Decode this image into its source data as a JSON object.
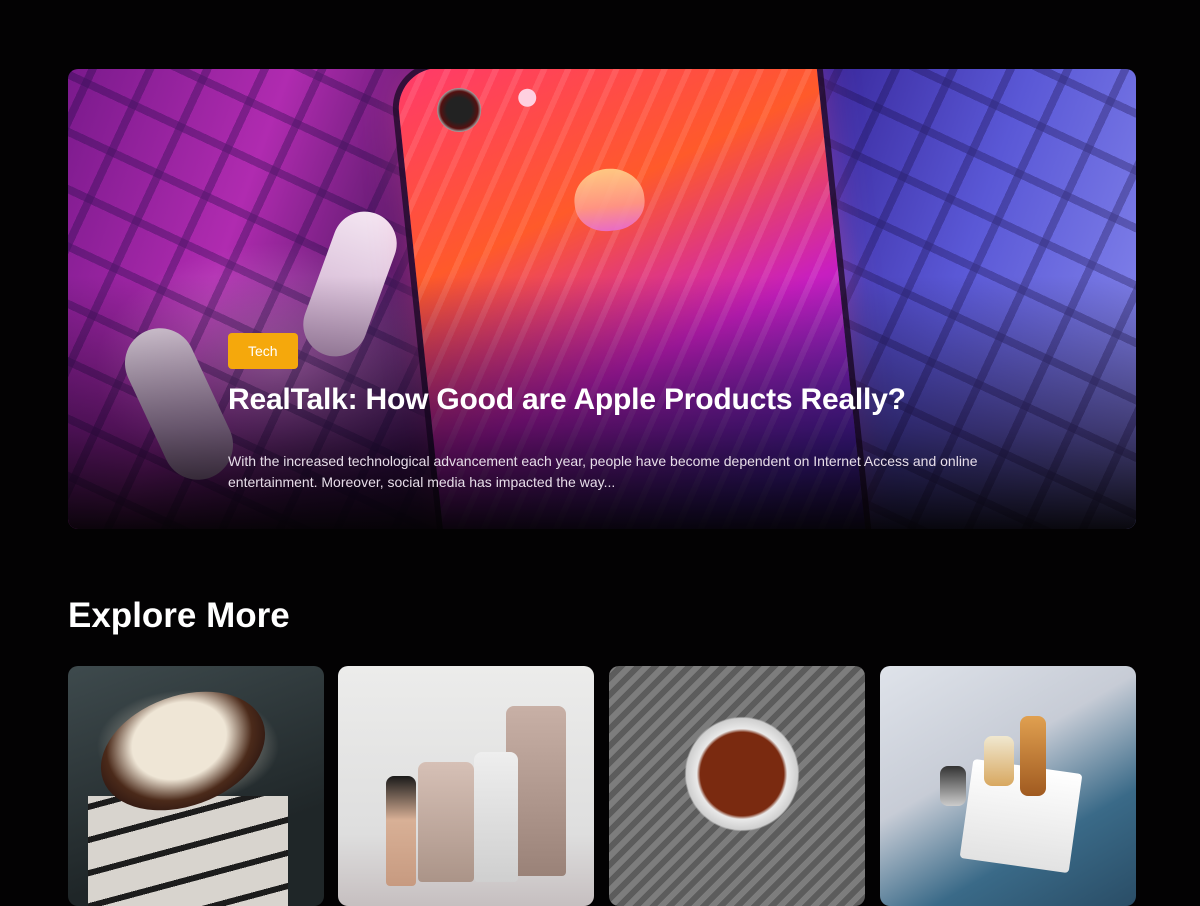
{
  "hero": {
    "tag": "Tech",
    "title": "RealTalk: How Good are Apple Products Really?",
    "excerpt": "With the increased technological advancement each year, people have become dependent on Internet Access and online entertainment. Moreover, social media has impacted the way..."
  },
  "explore": {
    "title": "Explore More",
    "cards": [
      {
        "image": "chocolate-egg-dessert"
      },
      {
        "image": "skincare-products"
      },
      {
        "image": "tea-cup-on-knit"
      },
      {
        "image": "perfume-bottles"
      }
    ]
  },
  "colors": {
    "background": "#030203",
    "tag": "#f5a80c",
    "text": "#ffffff"
  }
}
